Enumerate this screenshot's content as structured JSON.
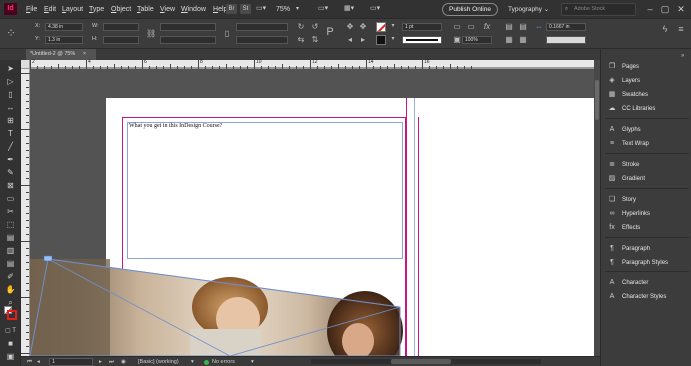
{
  "app": {
    "logo": "Id"
  },
  "menu": [
    {
      "label": "File",
      "ul": "F",
      "rest": "ile"
    },
    {
      "label": "Edit",
      "ul": "E",
      "rest": "dit"
    },
    {
      "label": "Layout",
      "ul": "L",
      "rest": "ayout"
    },
    {
      "label": "Type",
      "ul": "T",
      "rest": "ype"
    },
    {
      "label": "Object",
      "ul": "O",
      "rest": "bject"
    },
    {
      "label": "Table",
      "ul": "T",
      "rest": "able"
    },
    {
      "label": "View",
      "ul": "V",
      "rest": "iew"
    },
    {
      "label": "Window",
      "ul": "W",
      "rest": "indow"
    },
    {
      "label": "Help",
      "ul": "H",
      "rest": "elp"
    }
  ],
  "menubar": {
    "bridge_chip": "Br",
    "stock_chip": "St",
    "zoom": "75%",
    "publish_label": "Publish Online",
    "workspace_label": "Typography",
    "search_placeholder": "Adobe Stock"
  },
  "control": {
    "x_label": "X:",
    "x_value": "4.38 in",
    "y_label": "Y:",
    "y_value": "1.3 in",
    "w_label": "W:",
    "h_label": "H:",
    "stroke_weight": "1 pt",
    "opacity": "100%",
    "gap_value": "0.1667 in"
  },
  "tab": {
    "label": "*Untitled-2 @ 75%",
    "close": "×"
  },
  "ruler_top_numbers": [
    "2",
    "4",
    "6",
    "8",
    "10",
    "12",
    "14",
    "16"
  ],
  "text_frame": {
    "text": "What you get in this InDesign Course?"
  },
  "status": {
    "page_number": "1",
    "preflight_profile": "[Basic] (working)",
    "errors_label": "No errors"
  },
  "panels": [
    {
      "icon": "pages-icon",
      "glyph": "❐",
      "label": "Pages"
    },
    {
      "icon": "layers-icon",
      "glyph": "◈",
      "label": "Layers"
    },
    {
      "icon": "swatches-icon",
      "glyph": "▦",
      "label": "Swatches"
    },
    {
      "icon": "cc-libraries-icon",
      "glyph": "☁",
      "label": "CC Libraries"
    },
    {
      "icon": "glyphs-icon",
      "glyph": "A",
      "label": "Glyphs"
    },
    {
      "icon": "text-wrap-icon",
      "glyph": "≡",
      "label": "Text Wrap"
    },
    {
      "icon": "stroke-icon",
      "glyph": "≣",
      "label": "Stroke"
    },
    {
      "icon": "gradient-icon",
      "glyph": "▨",
      "label": "Gradient"
    },
    {
      "icon": "story-icon",
      "glyph": "❏",
      "label": "Story"
    },
    {
      "icon": "hyperlinks-icon",
      "glyph": "∞",
      "label": "Hyperlinks"
    },
    {
      "icon": "effects-icon",
      "glyph": "fx",
      "label": "Effects"
    },
    {
      "icon": "paragraph-icon",
      "glyph": "¶",
      "label": "Paragraph"
    },
    {
      "icon": "paragraph-styles-icon",
      "glyph": "¶",
      "label": "Paragraph Styles"
    },
    {
      "icon": "character-icon",
      "glyph": "A",
      "label": "Character"
    },
    {
      "icon": "character-styles-icon",
      "glyph": "A",
      "label": "Character Styles"
    }
  ],
  "colors": {
    "accent_magenta": "#c71585",
    "frame_blue": "#8aa6d6",
    "logo_bg": "#49021f",
    "logo_fg": "#ff3366",
    "status_ok": "#3bb54a"
  }
}
